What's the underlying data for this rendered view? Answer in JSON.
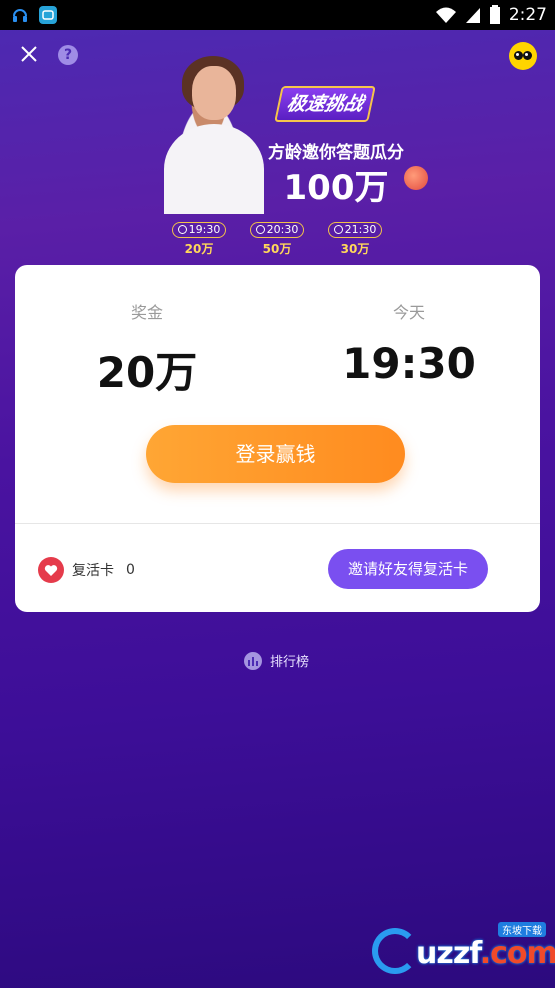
{
  "status_bar": {
    "time": "2:27",
    "icons": [
      "headset-icon",
      "app-icon",
      "wifi-icon",
      "signal-icon",
      "battery-icon"
    ]
  },
  "header": {
    "close_icon": "close-icon",
    "help_icon_label": "?",
    "profile_icon": "mascot-icon"
  },
  "banner": {
    "badge": "极速挑战",
    "subtitle": "方龄邀你答题瓜分",
    "amount": "100万",
    "schedule": [
      {
        "time": "19:30",
        "prize": "20万"
      },
      {
        "time": "20:30",
        "prize": "50万"
      },
      {
        "time": "21:30",
        "prize": "30万"
      }
    ]
  },
  "card": {
    "prize_label": "奖金",
    "prize_value": "20万",
    "day_label": "今天",
    "time_value": "19:30",
    "login_button": "登录赢钱",
    "revive_label": "复活卡",
    "revive_count": "0",
    "invite_button": "邀请好友得复活卡"
  },
  "leaderboard": {
    "label": "排行榜"
  },
  "watermark": {
    "text_main": "uzzf",
    "text_dot": ".com",
    "text_small": "东坡下载"
  },
  "colors": {
    "accent_orange": "#ff9a2a",
    "accent_purple": "#7a4ff0",
    "heart_red": "#e53b4b",
    "background_purple": "#4a13a0"
  }
}
